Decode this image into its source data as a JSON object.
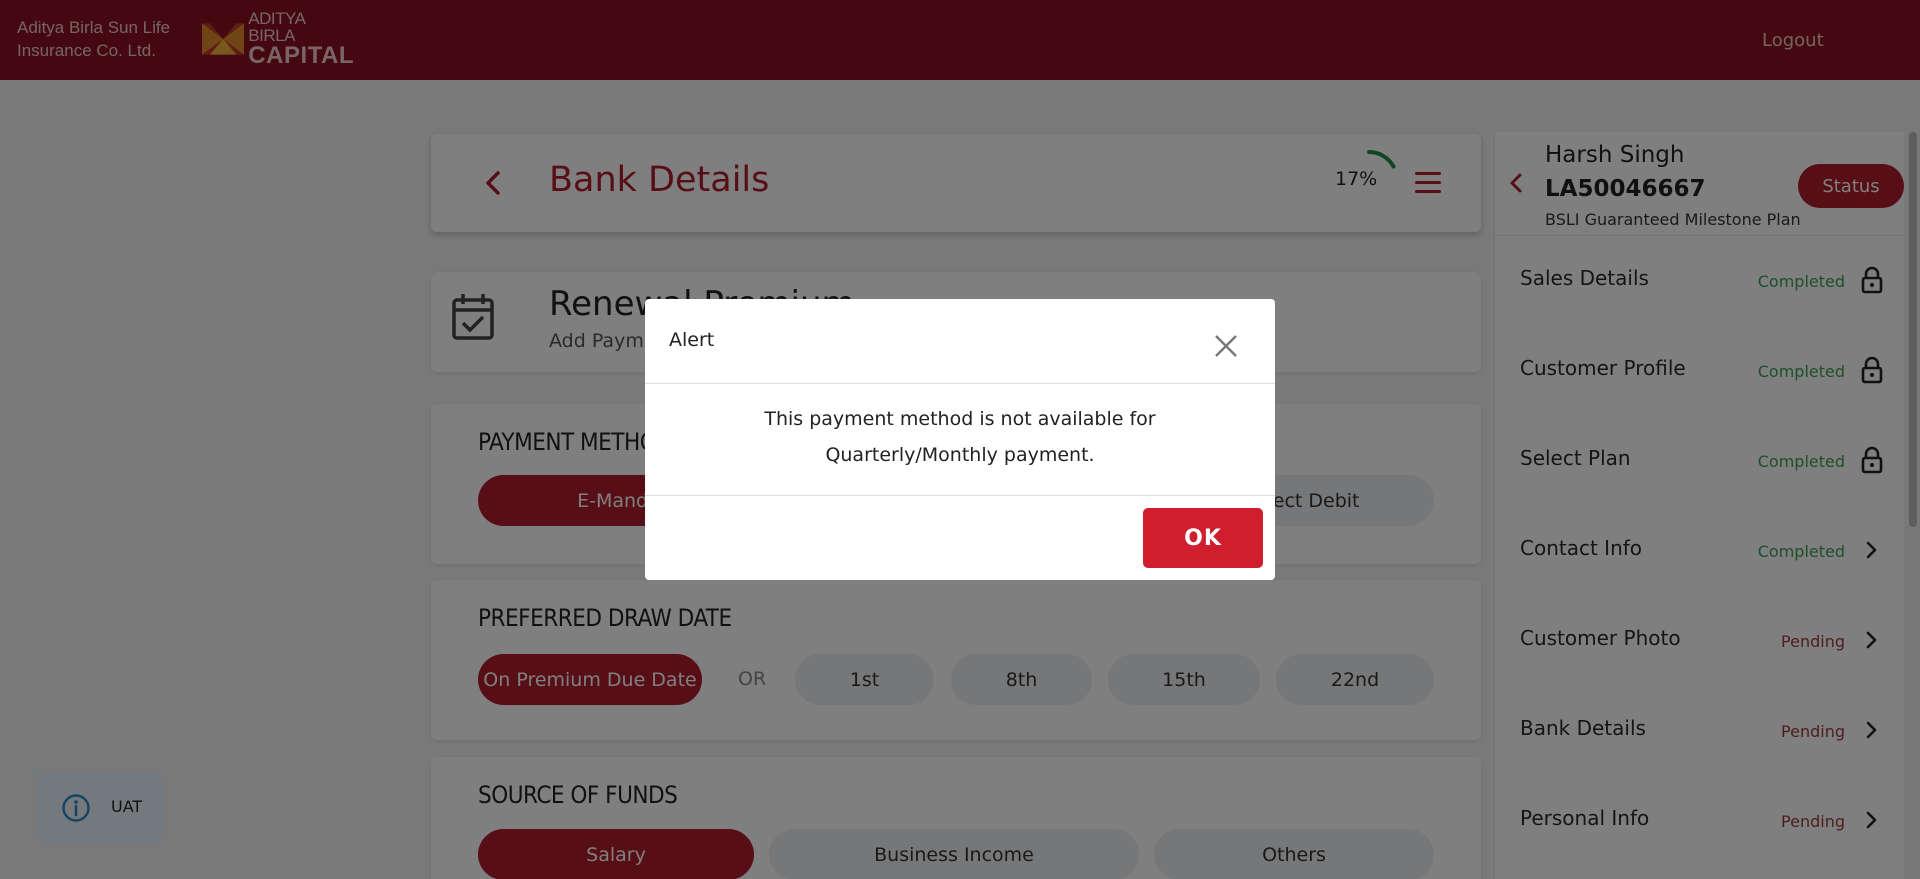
{
  "header": {
    "brand_line1": "Aditya Birla Sun Life",
    "brand_line2": "Insurance Co. Ltd.",
    "logo_line1": "ADITYA BIRLA",
    "logo_line2": "CAPITAL",
    "logout_label": "Logout"
  },
  "page": {
    "title": "Bank Details",
    "progress_text": "17%",
    "progress_fraction": 0.17
  },
  "renewal": {
    "title": "Renewal Premium",
    "subtitle": "Add Payment"
  },
  "payment_method": {
    "title": "PAYMENT METHOD",
    "options": [
      {
        "label": "E-Mandate",
        "active": true
      },
      {
        "label": "Direct Debit",
        "active": false
      }
    ]
  },
  "preferred_draw_date": {
    "title": "PREFERRED DRAW DATE",
    "primary": "On Premium Due Date",
    "or_label": "OR",
    "options": [
      "1st",
      "8th",
      "15th",
      "22nd"
    ]
  },
  "source_of_funds": {
    "title": "SOURCE OF FUNDS",
    "options": [
      {
        "label": "Salary",
        "active": true
      },
      {
        "label": "Business Income",
        "active": false
      },
      {
        "label": "Others",
        "active": false
      }
    ]
  },
  "side_panel": {
    "customer_name": "Harsh Singh",
    "application_id": "LA50046667",
    "plan_name": "BSLI Guaranteed Milestone Plan",
    "status_label": "Status",
    "items": [
      {
        "label": "Sales Details",
        "state": "Completed",
        "icon": "lock-icon"
      },
      {
        "label": "Customer Profile",
        "state": "Completed",
        "icon": "lock-icon"
      },
      {
        "label": "Select Plan",
        "state": "Completed",
        "icon": "lock-icon"
      },
      {
        "label": "Contact Info",
        "state": "Completed",
        "icon": "chevron-right-icon"
      },
      {
        "label": "Customer Photo",
        "state": "Pending",
        "icon": "chevron-right-icon"
      },
      {
        "label": "Bank Details",
        "state": "Pending",
        "icon": "chevron-right-icon"
      },
      {
        "label": "Personal Info",
        "state": "Pending",
        "icon": "chevron-right-icon"
      }
    ]
  },
  "env_badge": {
    "label": "UAT",
    "icon": "info-icon"
  },
  "modal": {
    "title": "Alert",
    "message": "This payment method is not available for Quarterly/Monthly payment.",
    "ok_label": "OK"
  },
  "colors": {
    "brand": "#8b1121",
    "accent": "#b01c2e",
    "ok_button": "#cf1f2e",
    "completed": "#3e9e52",
    "pending": "#9b3b3b",
    "progress_ring": "#1f8f4a"
  }
}
